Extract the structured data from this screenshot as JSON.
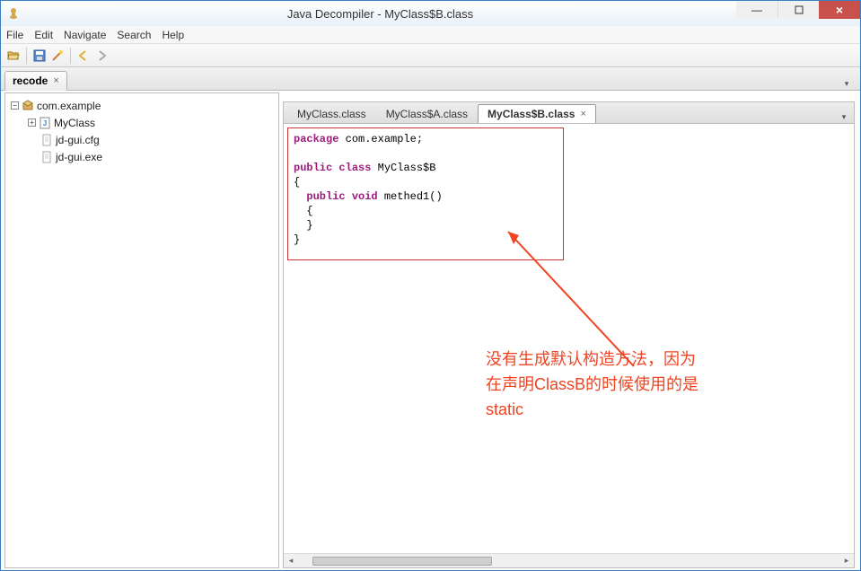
{
  "window": {
    "title": "Java Decompiler - MyClass$B.class"
  },
  "menu": {
    "file": "File",
    "edit": "Edit",
    "navigate": "Navigate",
    "search": "Search",
    "help": "Help"
  },
  "outerTab": {
    "label": "recode"
  },
  "tree": {
    "pkg": "com.example",
    "myclass": "MyClass",
    "cfg": "jd-gui.cfg",
    "exe": "jd-gui.exe"
  },
  "innerTabs": {
    "t0": "MyClass.class",
    "t1": "MyClass$A.class",
    "t2": "MyClass$B.class"
  },
  "code": {
    "pkg_kw": "package",
    "pkg_name": " com.example;",
    "pub_kw": "public",
    "class_kw": " class",
    "class_name": " MyClass$B",
    "lbrace": "{",
    "void_kw": " void",
    "method_name": " methed1()",
    "lbrace2": "  {",
    "rbrace2": "  }",
    "rbrace": "}"
  },
  "annotation": {
    "line1": "没有生成默认构造方法，因为",
    "line2": "在声明ClassB的时候使用的是",
    "line3": "static"
  }
}
